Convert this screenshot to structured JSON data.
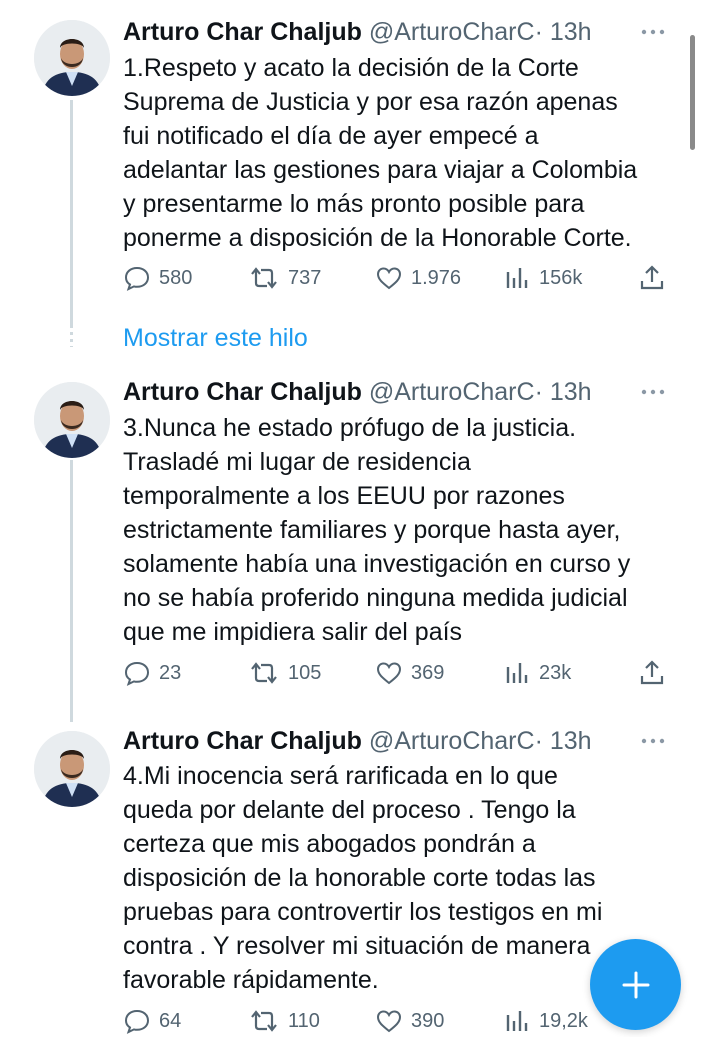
{
  "tweets": [
    {
      "name": "Arturo Char Chaljub",
      "handle": "@ArturoCharC",
      "time": "· 13h",
      "lines": [
        "1.Respeto  y acato la decisión de la Corte",
        "Suprema de Justicia y por esa razón apenas",
        "fui notificado el día de ayer empecé a",
        "adelantar las gestiones para viajar a Colombia",
        "y presentarme lo más pronto posible para",
        "ponerme a disposición de la Honorable Corte."
      ],
      "replies": "580",
      "retweets": "737",
      "likes": "1.976",
      "views": "156k"
    },
    {
      "name": "Arturo Char Chaljub",
      "handle": "@ArturoCharC",
      "time": "· 13h",
      "lines": [
        "3.Nunca he estado prófugo de la justicia.",
        "Trasladé mi lugar de residencia",
        "temporalmente a los EEUU por razones",
        "estrictamente familiares y porque hasta ayer,",
        "solamente había una investigación en curso y",
        "no se había proferido ninguna medida judicial",
        "que me impidiera salir del país"
      ],
      "replies": "23",
      "retweets": "105",
      "likes": "369",
      "views": "23k"
    },
    {
      "name": "Arturo Char Chaljub",
      "handle": "@ArturoCharC",
      "time": "· 13h",
      "lines": [
        "4.Mi inocencia será rarificada en lo que",
        "queda por delante del proceso . Tengo la",
        "certeza que mis abogados pondrán a",
        "disposición de la honorable corte todas las",
        "pruebas para controvertir los testigos en mi",
        "contra . Y resolver mi situación de manera",
        "favorable rápidamente."
      ],
      "replies": "64",
      "retweets": "110",
      "likes": "390",
      "views": "19,2k"
    }
  ],
  "show_thread": "Mostrar este hilo",
  "icons": {
    "reply": "reply-icon",
    "retweet": "retweet-icon",
    "like": "like-icon",
    "views": "views-icon",
    "share": "share-icon",
    "more": "more-icon",
    "compose": "compose-plus-icon"
  },
  "colors": {
    "accent": "#1d9bf0",
    "text": "#0f1419",
    "secondary": "#536471",
    "line": "#cfd9de"
  }
}
